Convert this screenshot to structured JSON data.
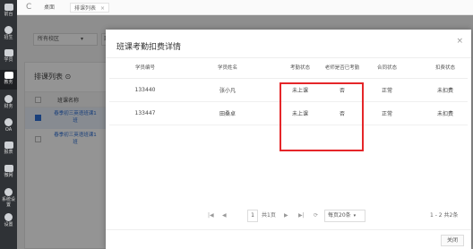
{
  "sidebar": {
    "items": [
      {
        "label": "前台",
        "icon": "desk-icon"
      },
      {
        "label": "招生",
        "icon": "enroll-icon"
      },
      {
        "label": "学员",
        "icon": "student-icon"
      },
      {
        "label": "教务",
        "icon": "teaching-icon"
      },
      {
        "label": "财务",
        "icon": "finance-icon"
      },
      {
        "label": "OA",
        "icon": "oa-icon"
      },
      {
        "label": "报表",
        "icon": "report-icon"
      },
      {
        "label": "微网",
        "icon": "microsite-icon"
      },
      {
        "label": "系统设置",
        "icon": "settings-icon"
      },
      {
        "label": "设置",
        "icon": "gear-icon"
      }
    ]
  },
  "topbar": {
    "refresh": "C",
    "tabs": [
      {
        "label": "桌面"
      },
      {
        "label": "排课列表",
        "close": "×"
      }
    ]
  },
  "background": {
    "filter_select": "所有校区",
    "filter_select_caret": "▾",
    "filter_select2": "班",
    "panel_title": "排课列表 ⊙",
    "header_label": "班课名称",
    "rows": [
      {
        "name": "春季初三英语班课1班"
      },
      {
        "name": "春季初三英语班课1班"
      }
    ]
  },
  "modal": {
    "title": "班课考勤扣费详情",
    "close": "×",
    "columns": [
      "学员编号",
      "学员姓名",
      "考勤状态",
      "老师是否已考勤",
      "合同状态",
      "扣费状态"
    ],
    "rows": [
      [
        "133440",
        "张小凡",
        "未上课",
        "否",
        "正常",
        "未扣费"
      ],
      [
        "133447",
        "田桑卓",
        "未上课",
        "否",
        "正常",
        "未扣费"
      ]
    ],
    "pager": {
      "first": "|◀",
      "prev": "◀",
      "current": "1",
      "total": "共1页",
      "next": "▶",
      "last": "▶|",
      "refresh": "⟳",
      "page_size": "每页20条",
      "caret": "▾",
      "range": "1 - 2 共2条"
    },
    "close_button": "关闭"
  }
}
